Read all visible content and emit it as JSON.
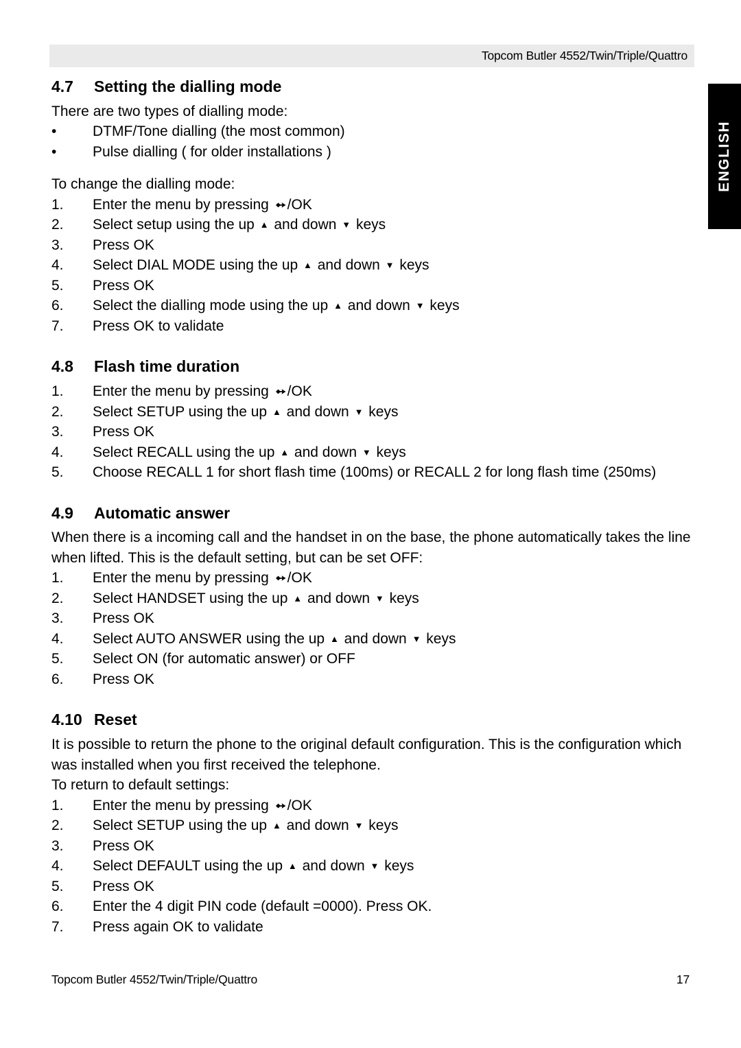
{
  "header": {
    "running_title": "Topcom Butler 4552/Twin/Triple/Quattro"
  },
  "language_tab": {
    "label": "ENGLISH"
  },
  "glyphs": {
    "ok_arrow": "ok-arrow-key-icon",
    "up_triangle": "▲",
    "down_triangle": "▼",
    "bullet": "•"
  },
  "sections": [
    {
      "number": "4.7",
      "title": "Setting the dialling mode",
      "intro": "There are two types of dialling mode:",
      "bullets": [
        "DTMF/Tone dialling (the most common)",
        "Pulse dialling ( for older installations )"
      ],
      "lead": "To change the dialling mode:",
      "steps": [
        {
          "n": "1.",
          "pre": "Enter the menu by pressing ",
          "mid": "",
          "post": "/OK",
          "type": "ok"
        },
        {
          "n": "2.",
          "pre": "Select setup using the up ",
          "mid": " and down ",
          "post": " keys",
          "type": "updown"
        },
        {
          "n": "3.",
          "pre": "Press OK",
          "mid": "",
          "post": "",
          "type": "plain"
        },
        {
          "n": "4.",
          "pre": "Select DIAL MODE using the up ",
          "mid": " and down ",
          "post": " keys",
          "type": "updown"
        },
        {
          "n": "5.",
          "pre": "Press OK",
          "mid": "",
          "post": "",
          "type": "plain"
        },
        {
          "n": "6.",
          "pre": "Select the dialling mode using the up ",
          "mid": " and down ",
          "post": " keys",
          "type": "updown"
        },
        {
          "n": "7.",
          "pre": "Press OK to validate",
          "mid": "",
          "post": "",
          "type": "plain"
        }
      ]
    },
    {
      "number": "4.8",
      "title": "Flash time duration",
      "steps": [
        {
          "n": "1.",
          "pre": "Enter the menu by pressing ",
          "mid": "",
          "post": "/OK",
          "type": "ok"
        },
        {
          "n": "2.",
          "pre": "Select SETUP using the up ",
          "mid": " and down ",
          "post": " keys",
          "type": "updown"
        },
        {
          "n": "3.",
          "pre": "Press OK",
          "mid": "",
          "post": "",
          "type": "plain"
        },
        {
          "n": "4.",
          "pre": "Select RECALL using the up ",
          "mid": " and down ",
          "post": " keys",
          "type": "updown"
        },
        {
          "n": "5.",
          "pre": "Choose RECALL 1 for short flash time (100ms) or RECALL 2 for long flash time (250ms)",
          "mid": "",
          "post": "",
          "type": "plain"
        }
      ]
    },
    {
      "number": "4.9",
      "title": "Automatic answer",
      "paragraph": "When there is a incoming call and the handset in on the base, the phone automatically takes the line when lifted. This is the default setting, but can be set OFF:",
      "steps": [
        {
          "n": "1.",
          "pre": "Enter the menu by pressing ",
          "mid": "",
          "post": "/OK",
          "type": "ok"
        },
        {
          "n": "2.",
          "pre": "Select HANDSET using the up ",
          "mid": " and down ",
          "post": " keys",
          "type": "updown"
        },
        {
          "n": "3.",
          "pre": "Press OK",
          "mid": "",
          "post": "",
          "type": "plain"
        },
        {
          "n": "4.",
          "pre": "Select AUTO ANSWER using the up ",
          "mid": " and down ",
          "post": " keys",
          "type": "updown"
        },
        {
          "n": "5.",
          "pre": "Select ON (for automatic answer) or OFF",
          "mid": "",
          "post": "",
          "type": "plain"
        },
        {
          "n": "6.",
          "pre": "Press OK",
          "mid": "",
          "post": "",
          "type": "plain"
        }
      ]
    },
    {
      "number": "4.10",
      "title": "Reset",
      "paragraph": "It is possible to return the phone to the original default configuration. This is the configuration which was installed when you first received the telephone.",
      "lead": "To return to default settings:",
      "steps": [
        {
          "n": "1.",
          "pre": "Enter the menu by pressing ",
          "mid": "",
          "post": "/OK",
          "type": "ok"
        },
        {
          "n": "2.",
          "pre": "Select SETUP using the up ",
          "mid": " and down ",
          "post": " keys",
          "type": "updown"
        },
        {
          "n": "3.",
          "pre": "Press OK",
          "mid": "",
          "post": "",
          "type": "plain"
        },
        {
          "n": "4.",
          "pre": "Select DEFAULT using the up ",
          "mid": " and down ",
          "post": " keys",
          "type": "updown"
        },
        {
          "n": "5.",
          "pre": "Press OK",
          "mid": "",
          "post": "",
          "type": "plain"
        },
        {
          "n": "6.",
          "pre": "Enter the 4 digit PIN code (default =0000). Press OK.",
          "mid": "",
          "post": "",
          "type": "plain"
        },
        {
          "n": "7.",
          "pre": "Press again OK to validate",
          "mid": "",
          "post": "",
          "type": "plain"
        }
      ]
    }
  ],
  "footer": {
    "document_title": "Topcom Butler 4552/Twin/Triple/Quattro",
    "page_number": "17"
  }
}
